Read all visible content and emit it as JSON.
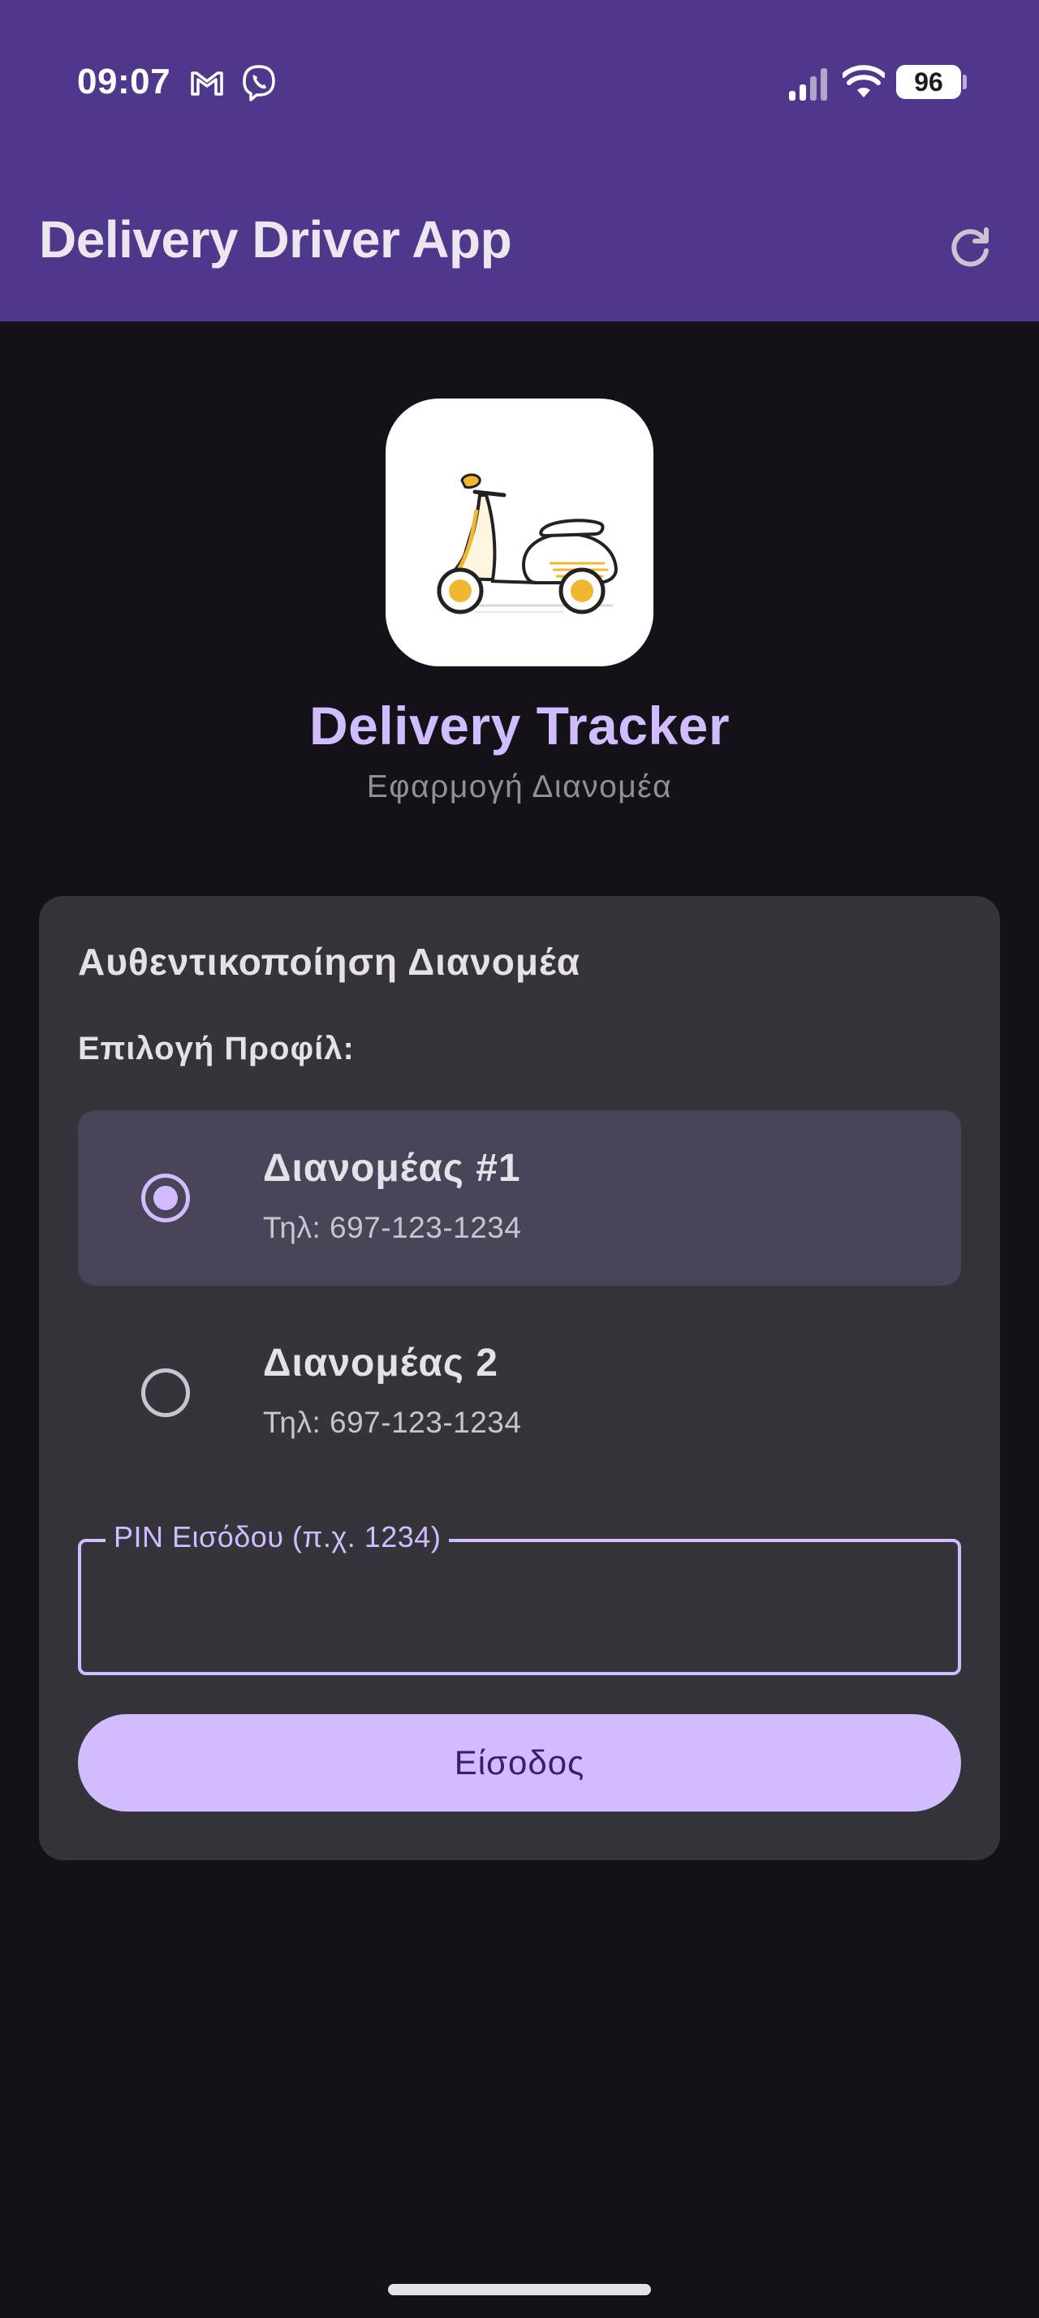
{
  "status_bar": {
    "time": "09:07",
    "battery": "96",
    "icons": [
      "gmail-icon",
      "viber-icon",
      "signal-icon",
      "wifi-icon",
      "battery-icon"
    ]
  },
  "app_bar": {
    "title": "Delivery Driver App",
    "refresh_icon": "refresh-icon"
  },
  "logo": {
    "icon": "scooter-icon",
    "title": "Delivery Tracker",
    "subtitle": "Εφαρμογή Διανομέα"
  },
  "auth": {
    "title": "Αυθεντικοποίηση Διανομέα",
    "profile_label": "Επιλογή Προφίλ:",
    "profiles": [
      {
        "name": "Διανομέας #1",
        "phone": "Τηλ: 697-123-1234",
        "selected": true
      },
      {
        "name": "Διανομέας 2",
        "phone": "Τηλ: 697-123-1234",
        "selected": false
      }
    ],
    "pin": {
      "label": "PIN Εισόδου (π.χ. 1234)",
      "value": ""
    },
    "login_label": "Είσοδος"
  },
  "colors": {
    "primary": "#d0bcff",
    "top_bar": "#4f378b",
    "background": "#141218",
    "card": "#36343b",
    "selected_option": "#4a4458",
    "on_primary": "#381e72"
  }
}
